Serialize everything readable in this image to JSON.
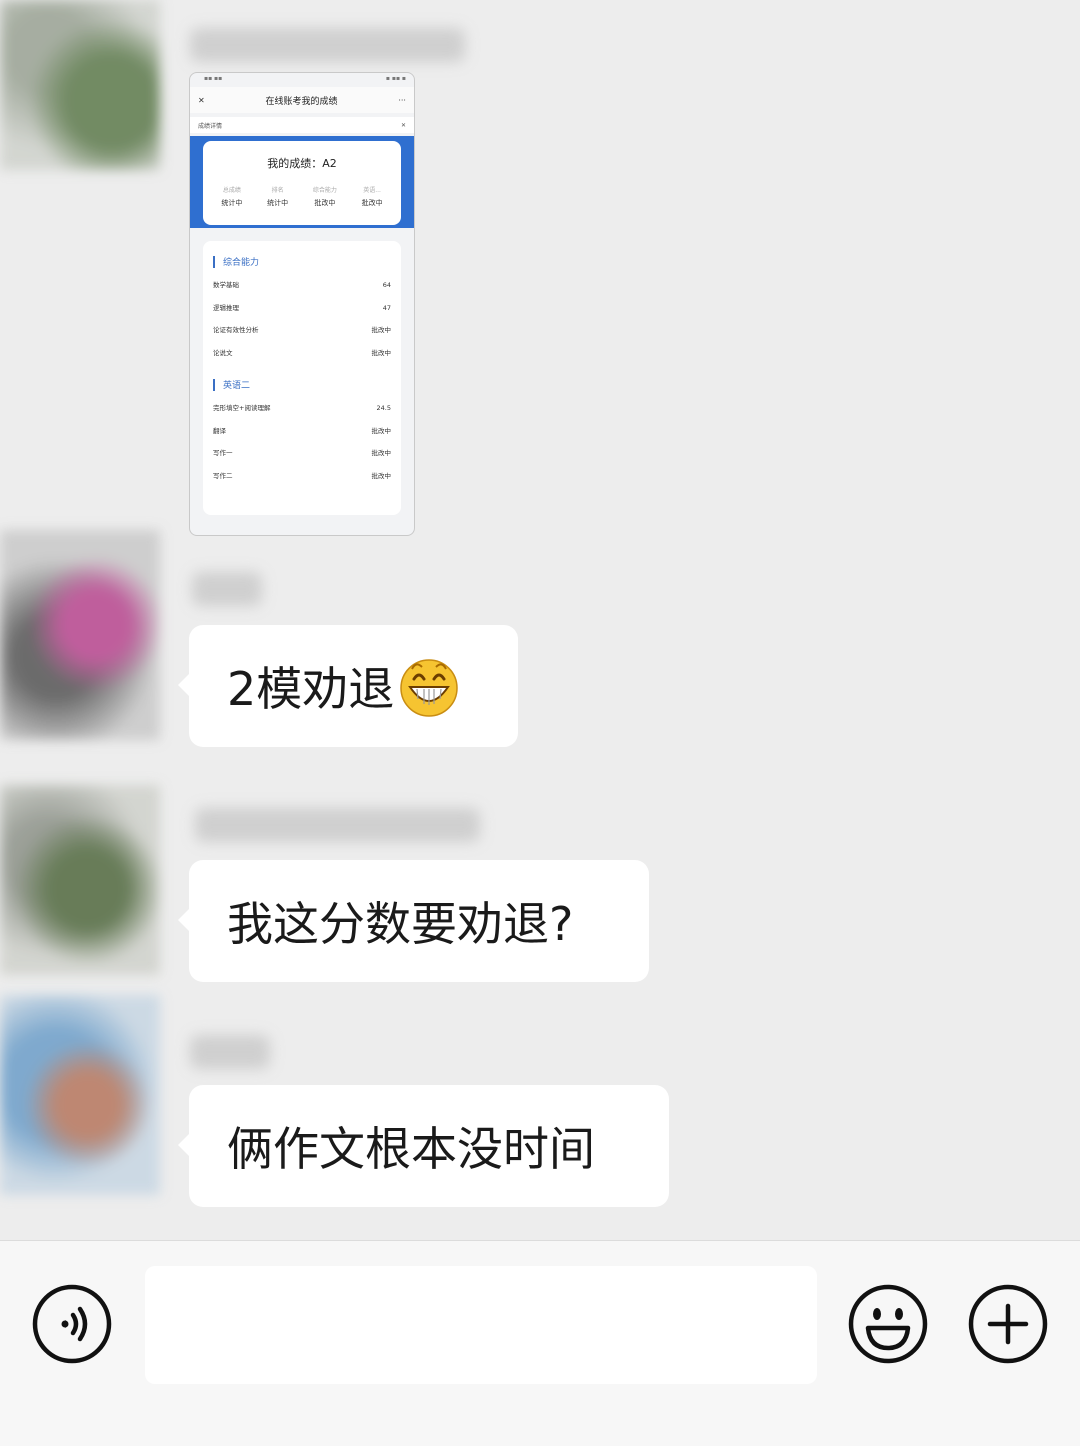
{
  "shared_image": {
    "window_title": "在线账考我的成绩",
    "sub_header": "成绩详情",
    "grade_label": "我的成绩：A2",
    "summary_cols": [
      {
        "head": "总成绩",
        "value": "统计中"
      },
      {
        "head": "排名",
        "value": "统计中"
      },
      {
        "head": "综合能力",
        "value": "批改中"
      },
      {
        "head": "英语...",
        "value": "批改中"
      }
    ],
    "sections": [
      {
        "title": "综合能力",
        "rows": [
          {
            "label": "数学基础",
            "value": "64"
          },
          {
            "label": "逻辑推理",
            "value": "47"
          },
          {
            "label": "论证有效性分析",
            "value": "批改中"
          },
          {
            "label": "论说文",
            "value": "批改中"
          }
        ]
      },
      {
        "title": "英语二",
        "rows": [
          {
            "label": "完形填空+阅读理解",
            "value": "24.5"
          },
          {
            "label": "翻译",
            "value": "批改中"
          },
          {
            "label": "写作一",
            "value": "批改中"
          },
          {
            "label": "写作二",
            "value": "批改中"
          }
        ]
      }
    ]
  },
  "messages": [
    {
      "text": "2模劝退",
      "emoji": "grinning-face"
    },
    {
      "text": "我这分数要劝退?"
    },
    {
      "text": "俩作文根本没时间"
    }
  ],
  "icons": {
    "voice": "voice-icon",
    "emoji": "emoji-icon",
    "plus": "plus-icon"
  }
}
